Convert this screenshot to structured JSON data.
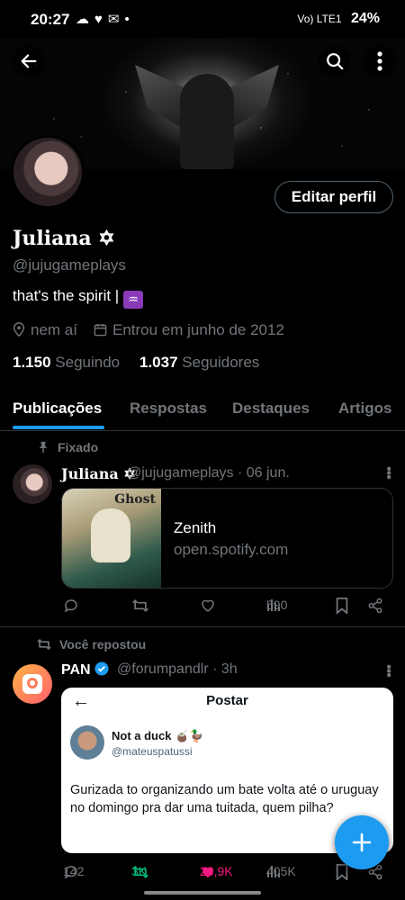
{
  "status_bar": {
    "time": "20:27",
    "network": "Vo) LTE1",
    "battery": "24%"
  },
  "profile": {
    "name": "Juliana",
    "name_emoji": "✡",
    "handle": "@jujugameplays",
    "bio": "that's the spirit |",
    "bio_emoji": "♒",
    "location": "nem aí",
    "joined": "Entrou em junho de 2012",
    "following_count": "1.150",
    "following_label": "Seguindo",
    "followers_count": "1.037",
    "followers_label": "Seguidores",
    "edit_label": "Editar perfil"
  },
  "tabs": [
    "Publicações",
    "Respostas",
    "Destaques",
    "Artigos"
  ],
  "pinned": {
    "label": "Fixado",
    "name": "Juliana",
    "name_emoji": "✡",
    "handle_date": "@jujugameplays · 06 jun.",
    "card_title": "Zenith",
    "card_url": "open.spotify.com",
    "card_logo": "Ghost",
    "views": "590"
  },
  "repost": {
    "label": "Você repostou",
    "name": "PAN",
    "handle_time": "@forumpandlr · 3h",
    "embed": {
      "header": "Postar",
      "author": "Not a duck",
      "author_emoji": "🧉🦆",
      "author_handle": "@mateuspatussi",
      "text": "Gurizada to organizando um bate volta até o uruguay no domingo pra dar uma tuitada, quem pilha?"
    },
    "replies": "142",
    "reposts": "3K",
    "likes": "20,9K",
    "views": "405K"
  },
  "colors": {
    "accent": "#1d9bf0",
    "like": "#f91880",
    "repost": "#00ba7c",
    "muted": "#71767b"
  }
}
